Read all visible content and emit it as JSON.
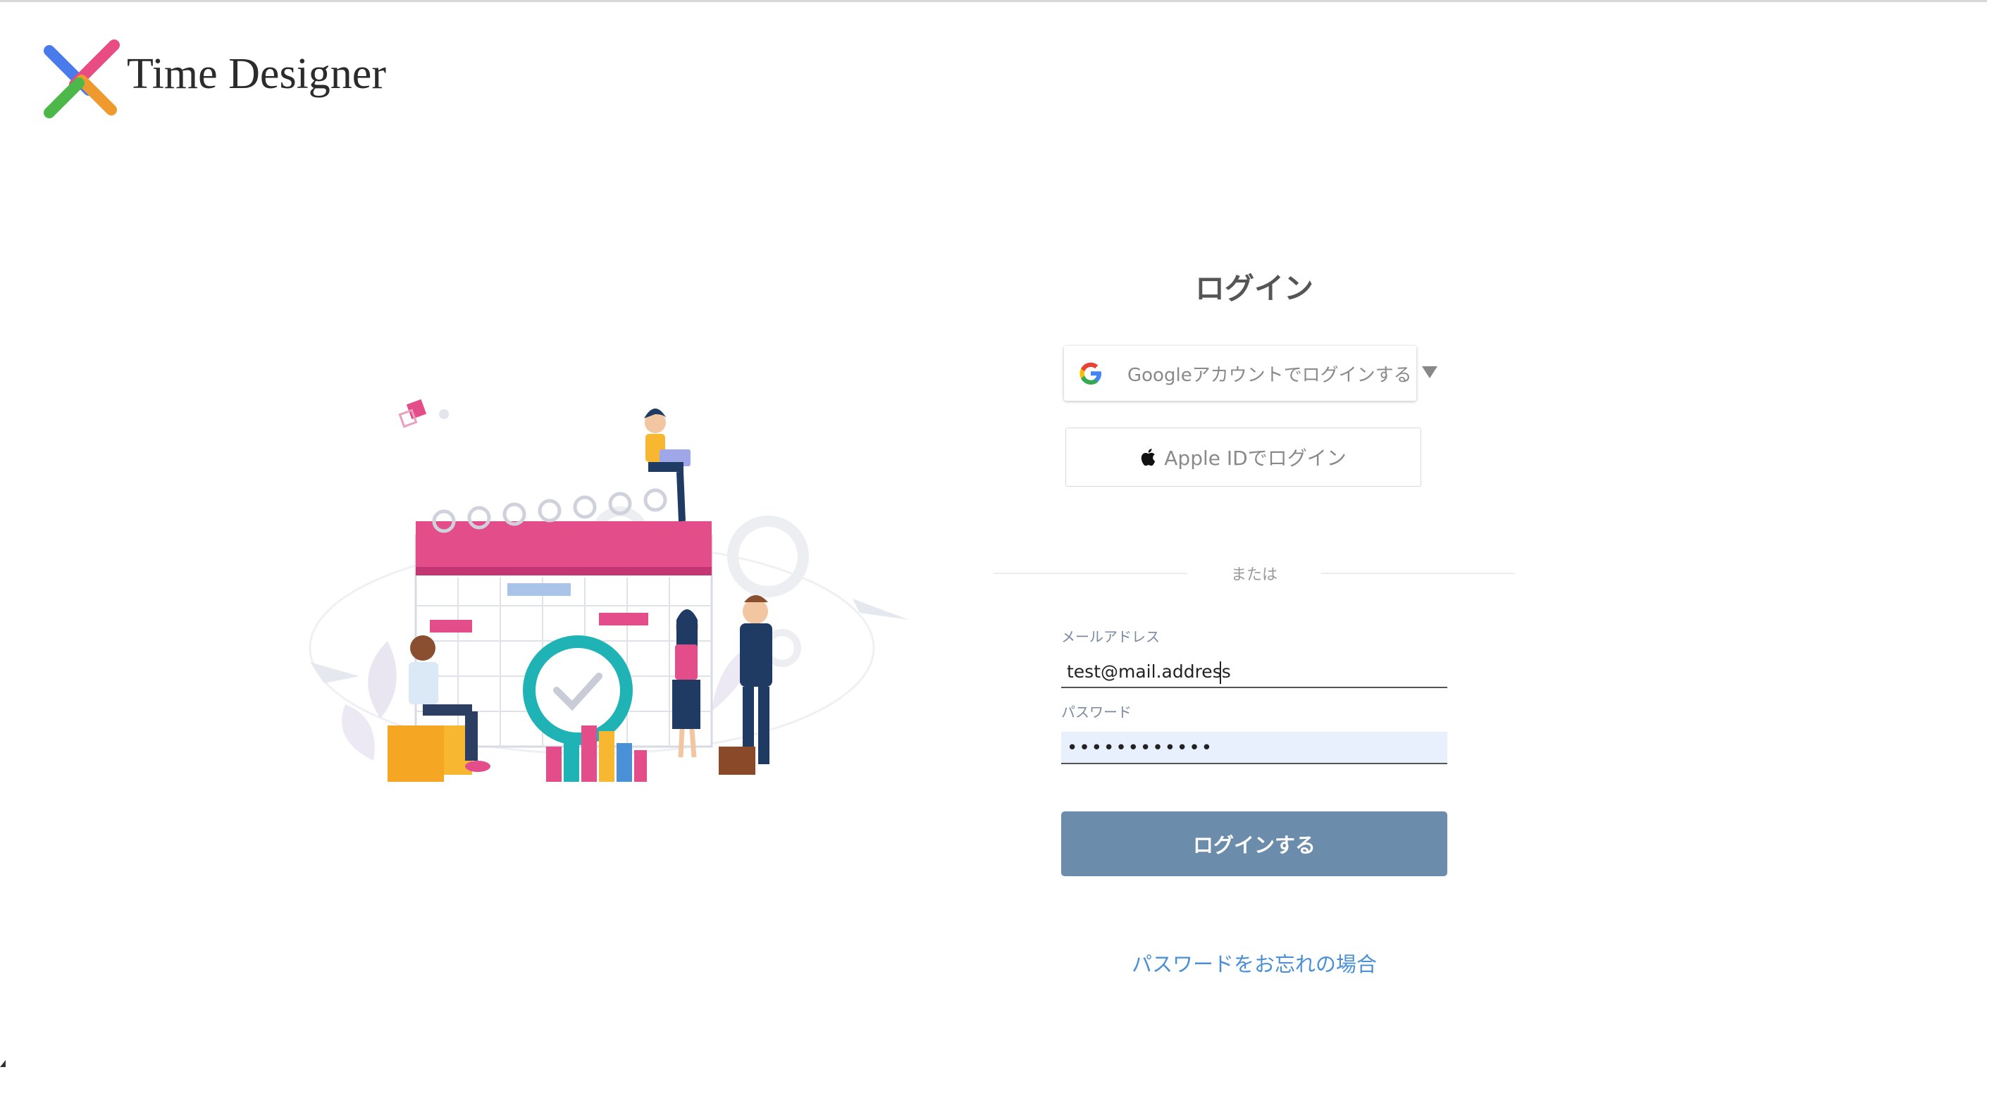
{
  "header": {
    "brand_name": "Time Designer",
    "logo_icon": "x-cross-logo-icon",
    "logo_colors": [
      "#4a7bea",
      "#e94b83",
      "#ef9a2f",
      "#4cb84a"
    ]
  },
  "login": {
    "title": "ログイン",
    "google_button_label": "Googleアカウントでログインする",
    "google_icon": "google-g-icon",
    "dropdown_icon": "caret-down-icon",
    "apple_button_label": "Apple IDでログイン",
    "apple_icon": "apple-icon",
    "divider_text": "または",
    "email_label": "メールアドレス",
    "email_value": "test@mail.address",
    "password_label": "パスワード",
    "password_value": "••••••••••••",
    "submit_label": "ログインする",
    "forgot_link": "パスワードをお忘れの場合"
  },
  "colors": {
    "submit_bg": "#6c8cab",
    "link": "#4a90d9",
    "calendar_pink": "#e34d8a",
    "clock_teal": "#1fb3b6"
  }
}
